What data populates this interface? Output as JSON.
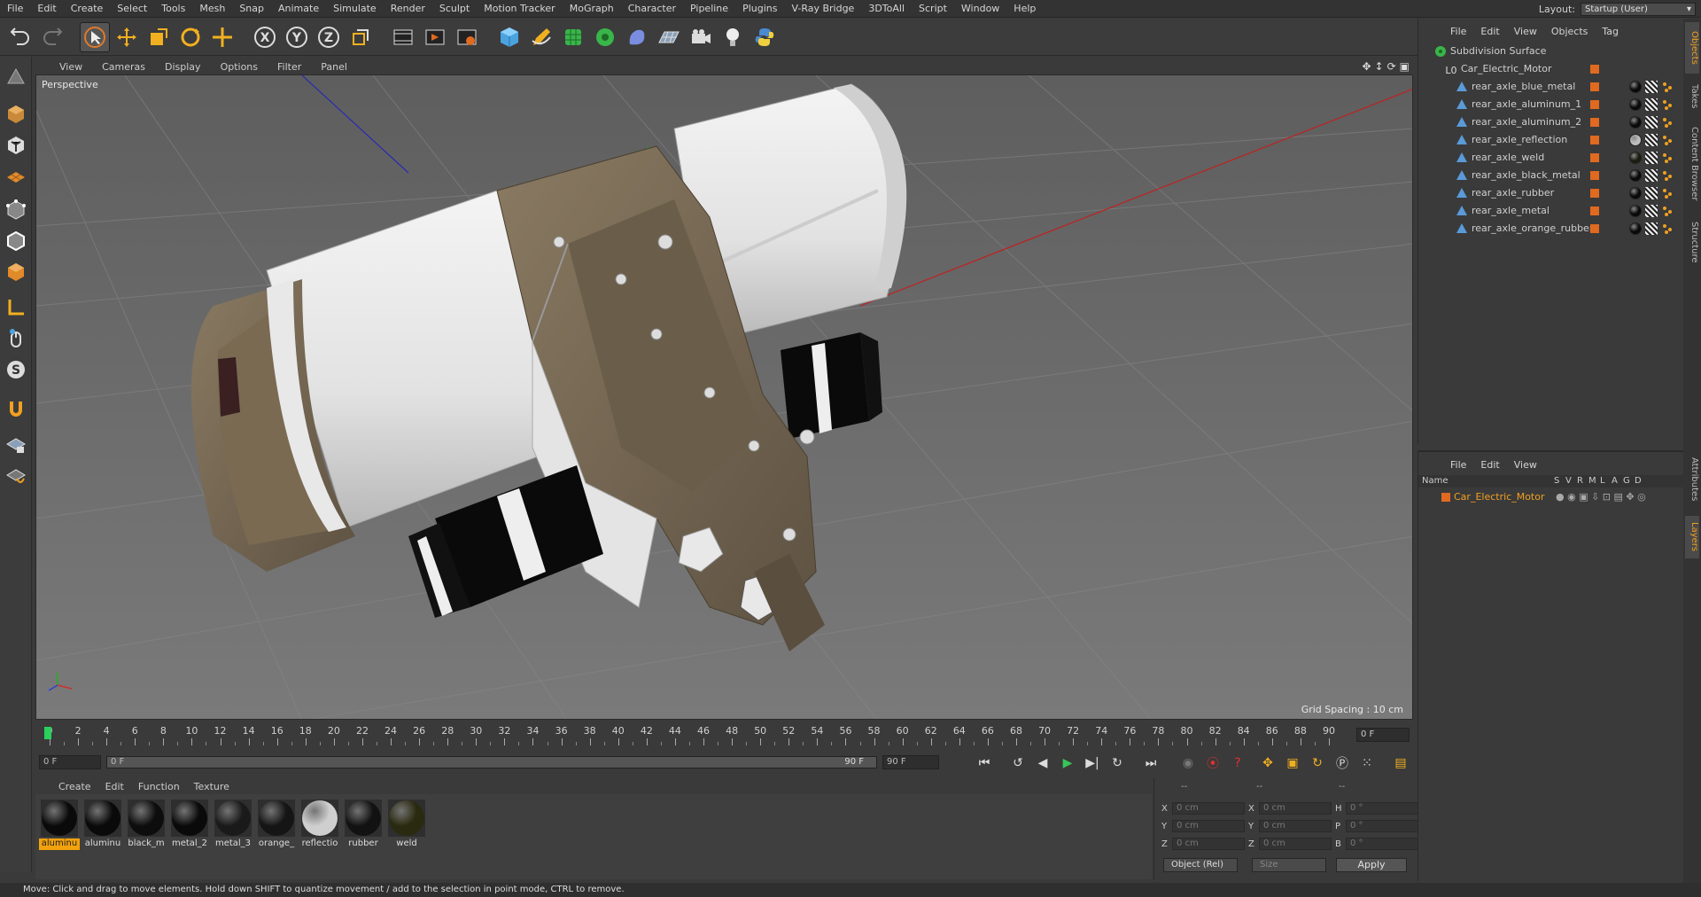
{
  "menubar": {
    "items": [
      "File",
      "Edit",
      "Create",
      "Select",
      "Tools",
      "Mesh",
      "Snap",
      "Animate",
      "Simulate",
      "Render",
      "Sculpt",
      "Motion Tracker",
      "MoGraph",
      "Character",
      "Pipeline",
      "Plugins",
      "V-Ray Bridge",
      "3DToAll",
      "Script",
      "Window",
      "Help"
    ],
    "layout_label": "Layout:",
    "layout_value": "Startup (User)"
  },
  "toolbar": {
    "icons": [
      "undo-icon",
      "redo-icon",
      "select-arrow-icon",
      "move-icon",
      "scale-icon",
      "rotate-icon",
      "live-select-icon",
      "x-axis-icon",
      "y-axis-icon",
      "z-axis-icon",
      "coordinate-system-icon",
      "render-view-icon",
      "render-picture-viewer-icon",
      "edit-render-settings-icon",
      "cube-icon",
      "pen-icon",
      "subdivision-icon",
      "array-icon",
      "deformer-icon",
      "floor-icon",
      "camera-icon",
      "light-icon",
      "python-icon"
    ]
  },
  "viewport": {
    "menu": [
      "View",
      "Cameras",
      "Display",
      "Options",
      "Filter",
      "Panel"
    ],
    "camera_label": "Perspective",
    "grid_spacing": "Grid Spacing : 10 cm"
  },
  "timeline": {
    "ticks": [
      "0",
      "2",
      "4",
      "6",
      "8",
      "10",
      "12",
      "14",
      "16",
      "18",
      "20",
      "22",
      "24",
      "26",
      "28",
      "30",
      "32",
      "34",
      "36",
      "38",
      "40",
      "42",
      "44",
      "46",
      "48",
      "50",
      "52",
      "54",
      "56",
      "58",
      "60",
      "62",
      "64",
      "66",
      "68",
      "70",
      "72",
      "74",
      "76",
      "78",
      "80",
      "82",
      "84",
      "86",
      "88",
      "90"
    ],
    "current_frame": "0 F"
  },
  "transport": {
    "start_field": "0 F",
    "range_start": "0 F",
    "range_end": "90 F",
    "end_field": "90 F"
  },
  "materials": {
    "menu": [
      "Create",
      "Edit",
      "Function",
      "Texture"
    ],
    "items": [
      {
        "name": "aluminu",
        "color": "#0a0a0a",
        "selected": true
      },
      {
        "name": "aluminu",
        "color": "#0a0a0a",
        "selected": false
      },
      {
        "name": "black_m",
        "color": "#0d0d0d",
        "selected": false
      },
      {
        "name": "metal_2",
        "color": "#0a0a0a",
        "selected": false
      },
      {
        "name": "metal_3",
        "color": "#1a1a1a",
        "selected": false
      },
      {
        "name": "orange_",
        "color": "#151515",
        "selected": false
      },
      {
        "name": "reflectio",
        "color": "#cfcfcf",
        "selected": false
      },
      {
        "name": "rubber",
        "color": "#121212",
        "selected": false
      },
      {
        "name": "weld",
        "color": "#2a2a10",
        "selected": false
      }
    ]
  },
  "coords": {
    "header": [
      "--",
      "--",
      "--"
    ],
    "rows": [
      {
        "l1": "X",
        "v1": "0 cm",
        "l2": "X",
        "v2": "0 cm",
        "l3": "H",
        "v3": "0 °"
      },
      {
        "l1": "Y",
        "v1": "0 cm",
        "l2": "Y",
        "v2": "0 cm",
        "l3": "P",
        "v3": "0 °"
      },
      {
        "l1": "Z",
        "v1": "0 cm",
        "l2": "Z",
        "v2": "0 cm",
        "l3": "B",
        "v3": "0 °"
      }
    ],
    "mode_select": "Object (Rel)",
    "size_select": "Size",
    "apply_label": "Apply"
  },
  "object_manager": {
    "menu": [
      "File",
      "Edit",
      "View",
      "Objects",
      "Tag"
    ],
    "objects": [
      {
        "name": "Subdivision Surface",
        "level": 0,
        "type": "subdivision"
      },
      {
        "name": "Car_Electric_Motor",
        "level": 1,
        "type": "null"
      },
      {
        "name": "rear_axle_blue_metal",
        "level": 2,
        "type": "polygon",
        "mat": "#0a0a0a"
      },
      {
        "name": "rear_axle_aluminum_1",
        "level": 2,
        "type": "polygon",
        "mat": "#0a0a0a"
      },
      {
        "name": "rear_axle_aluminum_2",
        "level": 2,
        "type": "polygon",
        "mat": "#0a0a0a"
      },
      {
        "name": "rear_axle_reflection",
        "level": 2,
        "type": "polygon",
        "mat": "#bdbdbd"
      },
      {
        "name": "rear_axle_weld",
        "level": 2,
        "type": "polygon",
        "mat": "#1c1c10"
      },
      {
        "name": "rear_axle_black_metal",
        "level": 2,
        "type": "polygon",
        "mat": "#0a0a0a"
      },
      {
        "name": "rear_axle_rubber",
        "level": 2,
        "type": "polygon",
        "mat": "#0a0a0a"
      },
      {
        "name": "rear_axle_metal",
        "level": 2,
        "type": "polygon",
        "mat": "#0a0a0a"
      },
      {
        "name": "rear_axle_orange_rubber",
        "level": 2,
        "type": "polygon",
        "mat": "#0a0a0a"
      }
    ]
  },
  "layer_manager": {
    "menu": [
      "File",
      "Edit",
      "View"
    ],
    "columns": [
      "Name",
      "S",
      "V",
      "R",
      "M",
      "L",
      "A",
      "G",
      "D"
    ],
    "layers": [
      {
        "name": "Car_Electric_Motor",
        "color": "#e06a1f"
      }
    ]
  },
  "side_tabs": [
    "Objects",
    "Takes",
    "Content Browser",
    "Structure",
    "Attributes",
    "Layers"
  ],
  "statusbar": {
    "text": "Move: Click and drag to move elements. Hold down SHIFT to quantize movement / add to the selection in point mode, CTRL to remove."
  }
}
